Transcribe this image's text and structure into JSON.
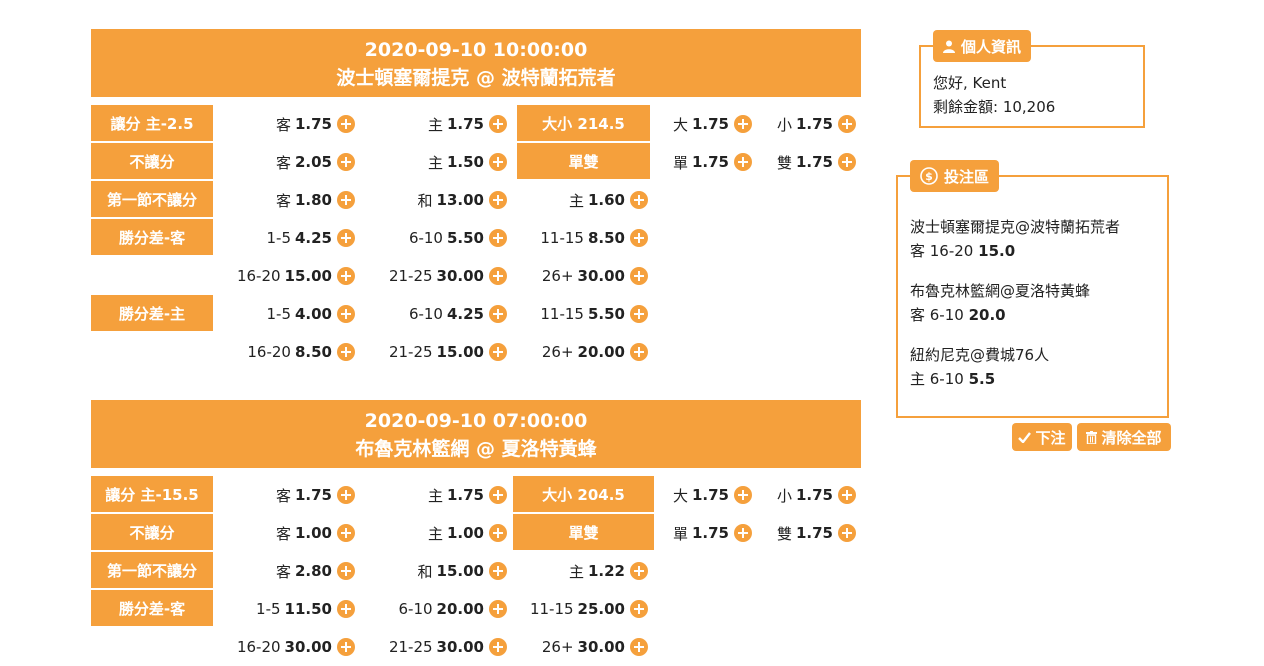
{
  "games": [
    {
      "time": "2020-09-10 10:00:00",
      "matchup": "波士頓塞爾提克 @ 波特蘭拓荒者",
      "rows": [
        {
          "label": "讓分 主-2.5",
          "cells": [
            [
              "客",
              "1.75"
            ],
            [
              "主",
              "1.75"
            ]
          ],
          "label2": "大小 214.5",
          "cells2": [
            [
              "大",
              "1.75"
            ],
            [
              "小",
              "1.75"
            ]
          ]
        },
        {
          "label": "不讓分",
          "cells": [
            [
              "客",
              "2.05"
            ],
            [
              "主",
              "1.50"
            ]
          ],
          "label2": "單雙",
          "cells2": [
            [
              "單",
              "1.75"
            ],
            [
              "雙",
              "1.75"
            ]
          ]
        },
        {
          "label": "第一節不讓分",
          "cells": [
            [
              "客",
              "1.80"
            ],
            [
              "和",
              "13.00"
            ],
            [
              "主",
              "1.60"
            ]
          ]
        },
        {
          "label": "勝分差-客",
          "cells": [
            [
              "1-5",
              "4.25"
            ],
            [
              "6-10",
              "5.50"
            ],
            [
              "11-15",
              "8.50"
            ]
          ]
        },
        {
          "label": "",
          "cells": [
            [
              "16-20",
              "15.00"
            ],
            [
              "21-25",
              "30.00"
            ],
            [
              "26+",
              "30.00"
            ]
          ]
        },
        {
          "label": "勝分差-主",
          "cells": [
            [
              "1-5",
              "4.00"
            ],
            [
              "6-10",
              "4.25"
            ],
            [
              "11-15",
              "5.50"
            ]
          ]
        },
        {
          "label": "",
          "cells": [
            [
              "16-20",
              "8.50"
            ],
            [
              "21-25",
              "15.00"
            ],
            [
              "26+",
              "20.00"
            ]
          ]
        }
      ]
    },
    {
      "time": "2020-09-10 07:00:00",
      "matchup": "布魯克林籃網 @ 夏洛特黃蜂",
      "rows": [
        {
          "label": "讓分 主-15.5",
          "cells": [
            [
              "客",
              "1.75"
            ],
            [
              "主",
              "1.75"
            ]
          ],
          "label2": "大小 204.5",
          "cells2": [
            [
              "大",
              "1.75"
            ],
            [
              "小",
              "1.75"
            ]
          ]
        },
        {
          "label": "不讓分",
          "cells": [
            [
              "客",
              "1.00"
            ],
            [
              "主",
              "1.00"
            ]
          ],
          "label2": "單雙",
          "cells2": [
            [
              "單",
              "1.75"
            ],
            [
              "雙",
              "1.75"
            ]
          ]
        },
        {
          "label": "第一節不讓分",
          "cells": [
            [
              "客",
              "2.80"
            ],
            [
              "和",
              "15.00"
            ],
            [
              "主",
              "1.22"
            ]
          ]
        },
        {
          "label": "勝分差-客",
          "cells": [
            [
              "1-5",
              "11.50"
            ],
            [
              "6-10",
              "20.00"
            ],
            [
              "11-15",
              "25.00"
            ]
          ]
        },
        {
          "label": "",
          "cells": [
            [
              "16-20",
              "30.00"
            ],
            [
              "21-25",
              "30.00"
            ],
            [
              "26+",
              "30.00"
            ]
          ]
        }
      ]
    }
  ],
  "user_info": {
    "legend": "個人資訊",
    "greeting": "您好, Kent",
    "balance_label": "剩餘金額: ",
    "balance": "10,206"
  },
  "bet_zone": {
    "legend": "投注區",
    "items": [
      {
        "match": "波士頓塞爾提克@波特蘭拓荒者",
        "pick": "客 16-20",
        "odds": "15.0"
      },
      {
        "match": "布魯克林籃網@夏洛特黃蜂",
        "pick": "客 6-10",
        "odds": "20.0"
      },
      {
        "match": "紐約尼克@費城76人",
        "pick": "主 6-10",
        "odds": "5.5"
      }
    ]
  },
  "buttons": {
    "place_bet": "下注",
    "clear_all": "清除全部"
  },
  "icons": {
    "user": "user-icon",
    "dollar": "dollar-circle-icon",
    "check": "check-icon",
    "trash": "trash-icon",
    "add": "plus-circle-icon"
  },
  "colors": {
    "accent": "#f5a03c"
  }
}
